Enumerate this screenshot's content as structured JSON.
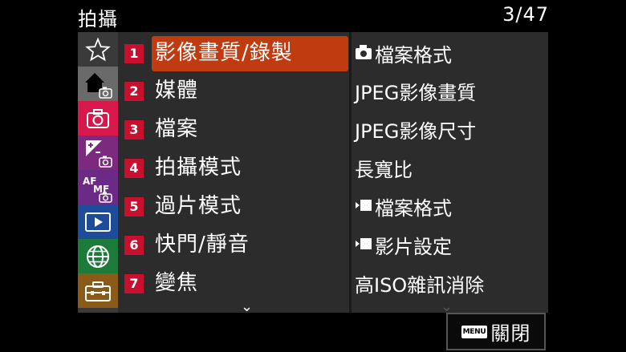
{
  "header": {
    "title": "拍攝",
    "page": "3/47"
  },
  "tabs": [
    {
      "name": "my-menu",
      "icon": "star-icon",
      "color": "#3a3a3a"
    },
    {
      "name": "main-shooting",
      "icon": "home-camera-icon",
      "color": "#6a6a6a"
    },
    {
      "name": "shooting",
      "icon": "camera-icon",
      "color": "#d8174a"
    },
    {
      "name": "exposure-color",
      "icon": "exposure-camera-icon",
      "color": "#7b2a7e"
    },
    {
      "name": "focus",
      "icon": "af-mf-camera-icon",
      "color": "#6a2a86"
    },
    {
      "name": "playback",
      "icon": "play-icon",
      "color": "#1f4c9a"
    },
    {
      "name": "network",
      "icon": "globe-icon",
      "color": "#1c7a3a"
    },
    {
      "name": "setup",
      "icon": "toolbox-icon",
      "color": "#8a5a18"
    }
  ],
  "menu": {
    "items": [
      {
        "number": "1",
        "label": "影像畫質/錄製"
      },
      {
        "number": "2",
        "label": "媒體"
      },
      {
        "number": "3",
        "label": "檔案"
      },
      {
        "number": "4",
        "label": "拍攝模式"
      },
      {
        "number": "5",
        "label": "過片模式"
      },
      {
        "number": "6",
        "label": "快門/靜音"
      },
      {
        "number": "7",
        "label": "變焦"
      }
    ],
    "selected_index": 0
  },
  "submenu": {
    "items": [
      {
        "icon": "camera-small-icon",
        "label": "檔案格式"
      },
      {
        "icon": "",
        "label": "JPEG影像畫質"
      },
      {
        "icon": "",
        "label": "JPEG影像尺寸"
      },
      {
        "icon": "",
        "label": "長寬比"
      },
      {
        "icon": "movie-small-icon",
        "label": "檔案格式"
      },
      {
        "icon": "movie-small-icon",
        "label": "影片設定"
      },
      {
        "icon": "",
        "label": "高ISO雜訊消除"
      }
    ]
  },
  "scroll": {
    "arrow": "⌄"
  },
  "footer": {
    "menu_key": "MENU",
    "close_label": "關閉"
  }
}
